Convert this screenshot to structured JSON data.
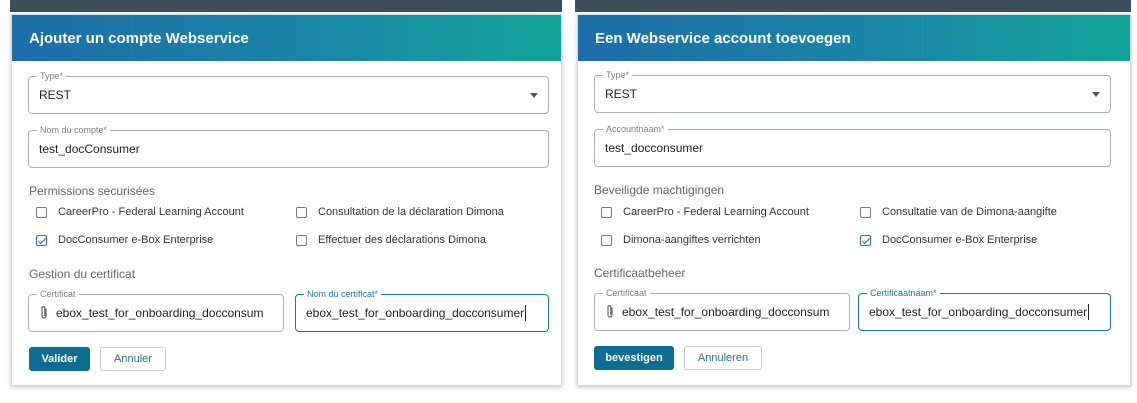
{
  "background": {
    "left_text": "",
    "right_text": ""
  },
  "dialogs": {
    "fr": {
      "title": "Ajouter un compte Webservice",
      "type_label": "Type*",
      "type_value": "REST",
      "account_label": "Nom du compte*",
      "account_value": "test_docConsumer",
      "permissions_title": "Permissions securisées",
      "permissions": [
        {
          "label": "CareerPro - Federal Learning Account",
          "checked": false
        },
        {
          "label": "Consultation de la déclaration Dimona",
          "checked": false
        },
        {
          "label": "DocConsumer e-Box Enterprise",
          "checked": true
        },
        {
          "label": "Effectuer des déclarations Dimona",
          "checked": false
        }
      ],
      "cert_title": "Gestion du certificat",
      "cert_label": "Certificat",
      "cert_value": "ebox_test_for_onboarding_docconsum",
      "cert_name_label": "Nom du certificat*",
      "cert_name_value": "ebox_test_for_onboarding_docconsumer",
      "confirm_label": "Valider",
      "cancel_label": "Annuler"
    },
    "nl": {
      "title": "Een Webservice account toevoegen",
      "type_label": "Type*",
      "type_value": "REST",
      "account_label": "Accountnaam*",
      "account_value": "test_docconsumer",
      "permissions_title": "Beveiligde machtigingen",
      "permissions": [
        {
          "label": "CareerPro - Federal Learning Account",
          "checked": false
        },
        {
          "label": "Consultatie van de Dimona-aangifte",
          "checked": false
        },
        {
          "label": "Dimona-aangiftes verrichten",
          "checked": false
        },
        {
          "label": "DocConsumer e-Box Enterprise",
          "checked": true
        }
      ],
      "cert_title": "Certificaatbeheer",
      "cert_label": "Certificaat",
      "cert_value": "ebox_test_for_onboarding_docconsum",
      "cert_name_label": "Certificaatnaam*",
      "cert_name_value": "ebox_test_for_onboarding_docconsumer",
      "confirm_label": "bevestigen",
      "cancel_label": "Annuleren"
    }
  },
  "colors": {
    "header_start": "#1d6ea8",
    "header_end": "#12a49a",
    "primary": "#0e6d93",
    "focus": "#1a7aa8"
  },
  "icons": {
    "select_caret": "chevron-down-icon",
    "attachment": "paperclip-icon",
    "checkbox": "check-icon"
  }
}
